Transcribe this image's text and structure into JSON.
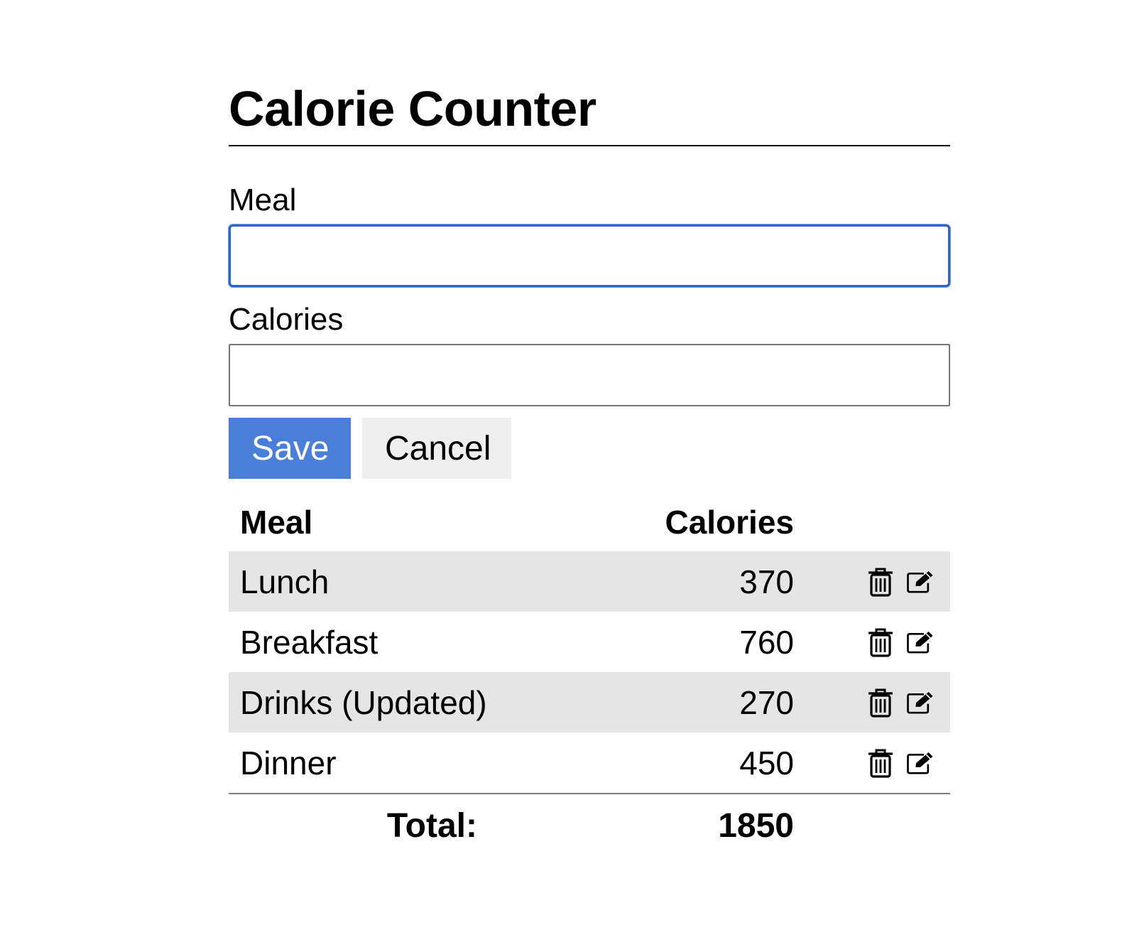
{
  "title": "Calorie Counter",
  "form": {
    "meal_label": "Meal",
    "meal_value": "",
    "calories_label": "Calories",
    "calories_value": "",
    "save_label": "Save",
    "cancel_label": "Cancel"
  },
  "table": {
    "headers": {
      "meal": "Meal",
      "calories": "Calories"
    },
    "rows": [
      {
        "meal": "Lunch",
        "calories": "370"
      },
      {
        "meal": "Breakfast",
        "calories": "760"
      },
      {
        "meal": "Drinks (Updated)",
        "calories": "270"
      },
      {
        "meal": "Dinner",
        "calories": "450"
      }
    ],
    "total_label": "Total:",
    "total_value": "1850"
  },
  "icons": {
    "delete": "trash-icon",
    "edit": "edit-icon"
  },
  "colors": {
    "save_button": "#4a7fd9",
    "cancel_button": "#eeeeee",
    "focus_border": "#2f64c8",
    "stripe": "#e5e5e5"
  }
}
